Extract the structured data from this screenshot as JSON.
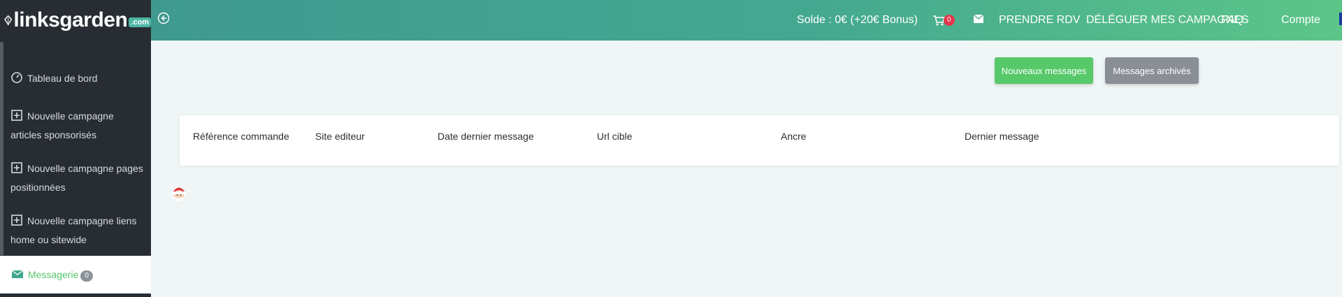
{
  "brand": {
    "name": "linksgarden",
    "tld": ".com"
  },
  "sidebar": {
    "items": [
      {
        "label": "Tableau de bord",
        "icon": "dashboard-icon"
      },
      {
        "label": "Nouvelle campagne articles sponsorisés",
        "icon": "plus-square-icon"
      },
      {
        "label": "Nouvelle campagne pages positionnées",
        "icon": "plus-square-icon"
      },
      {
        "label": "Nouvelle campagne liens home ou sitewide",
        "icon": "plus-square-icon"
      },
      {
        "label": "Messagerie",
        "icon": "envelope-icon",
        "badge": "0",
        "active": true
      }
    ]
  },
  "header": {
    "balance": "Solde : 0€ (+20€ Bonus)",
    "cart_count": "0",
    "nav": [
      "PRENDRE RDV",
      "DÉLÉGUER MES CAMPAGNES",
      "FAQ",
      "Compte"
    ]
  },
  "actions": {
    "new_messages": "Nouveaux messages",
    "archived_messages": "Messages archivés"
  },
  "table": {
    "columns": [
      "Référence commande",
      "Site editeur",
      "Date dernier message",
      "Url cible",
      "Ancre",
      "Dernier message"
    ],
    "rows": []
  },
  "colors": {
    "sidebar_bg": "#272d33",
    "accent_green": "#58c96a",
    "header_start": "#3f998f",
    "header_end": "#5cc588",
    "badge_red": "#e5364d"
  }
}
